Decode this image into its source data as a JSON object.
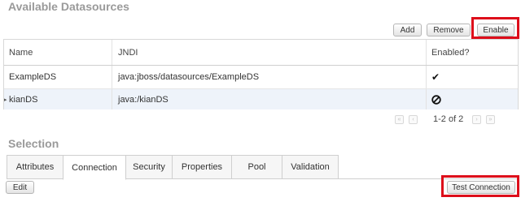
{
  "available": {
    "title": "Available Datasources",
    "toolbar": {
      "add_label": "Add",
      "remove_label": "Remove",
      "enable_label": "Enable"
    }
  },
  "table": {
    "columns": [
      "Name",
      "JNDI",
      "Enabled?"
    ],
    "rows": [
      {
        "name": "ExampleDS",
        "jndi": "java:jboss/datasources/ExampleDS",
        "enabled": true,
        "enabled_icon": "check-icon"
      },
      {
        "name": "kianDS",
        "jndi": "java:/kianDS",
        "enabled": false,
        "enabled_icon": "disabled-icon",
        "selected": true
      }
    ]
  },
  "pager": {
    "text": "1-2 of 2"
  },
  "selection": {
    "title": "Selection",
    "tabs": [
      "Attributes",
      "Connection",
      "Security",
      "Properties",
      "Pool",
      "Validation"
    ],
    "active_tab": "Connection",
    "edit_label": "Edit",
    "test_connection_label": "Test Connection"
  },
  "colors": {
    "highlight": "#dd0d1a",
    "title": "#9a9a9a",
    "selected_row": "#eef3fa"
  }
}
